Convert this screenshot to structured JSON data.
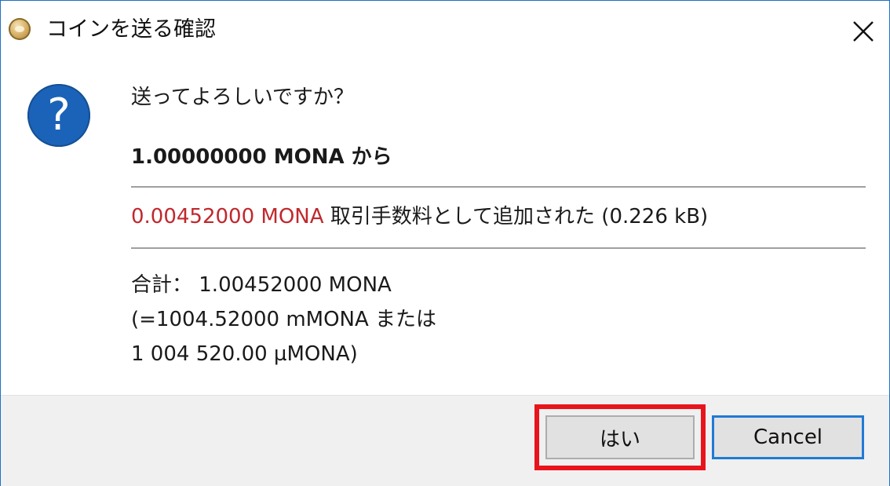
{
  "window": {
    "title": "コインを送る確認",
    "close_symbol": "✕"
  },
  "message": {
    "question": "送ってよろしいですか？",
    "amount_line": "1.00000000 MONA から",
    "fee_amount": "0.00452000 MONA",
    "fee_text": " 取引手数料として追加された (0.226 kB)",
    "total_line_1": "合計： 1.00452000 MONA",
    "total_line_2": "(=1004.52000 mMONA または",
    "total_line_3": "1 004 520.00 µMONA)"
  },
  "buttons": {
    "yes_label": "はい",
    "cancel_label": "Cancel"
  },
  "icons": {
    "app_icon": "monacoin-coin-icon",
    "question_icon": "question-icon",
    "question_glyph": "?",
    "close_icon": "close-icon"
  },
  "colors": {
    "fee_red": "#c0282d",
    "question_blue": "#1b63b8",
    "cancel_focus_blue": "#1f7ad6",
    "highlight_red": "#e8141b"
  }
}
